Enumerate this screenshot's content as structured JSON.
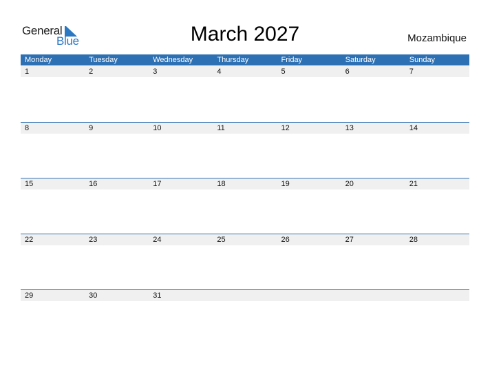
{
  "logo": {
    "general": "General",
    "blue": "Blue"
  },
  "title": "March 2027",
  "country": "Mozambique",
  "weekdays": [
    "Monday",
    "Tuesday",
    "Wednesday",
    "Thursday",
    "Friday",
    "Saturday",
    "Sunday"
  ],
  "weeks": [
    [
      "1",
      "2",
      "3",
      "4",
      "5",
      "6",
      "7"
    ],
    [
      "8",
      "9",
      "10",
      "11",
      "12",
      "13",
      "14"
    ],
    [
      "15",
      "16",
      "17",
      "18",
      "19",
      "20",
      "21"
    ],
    [
      "22",
      "23",
      "24",
      "25",
      "26",
      "27",
      "28"
    ],
    [
      "29",
      "30",
      "31",
      "",
      "",
      "",
      ""
    ]
  ],
  "colors": {
    "accent": "#2d70b3",
    "row_band": "#f0f0f0"
  }
}
